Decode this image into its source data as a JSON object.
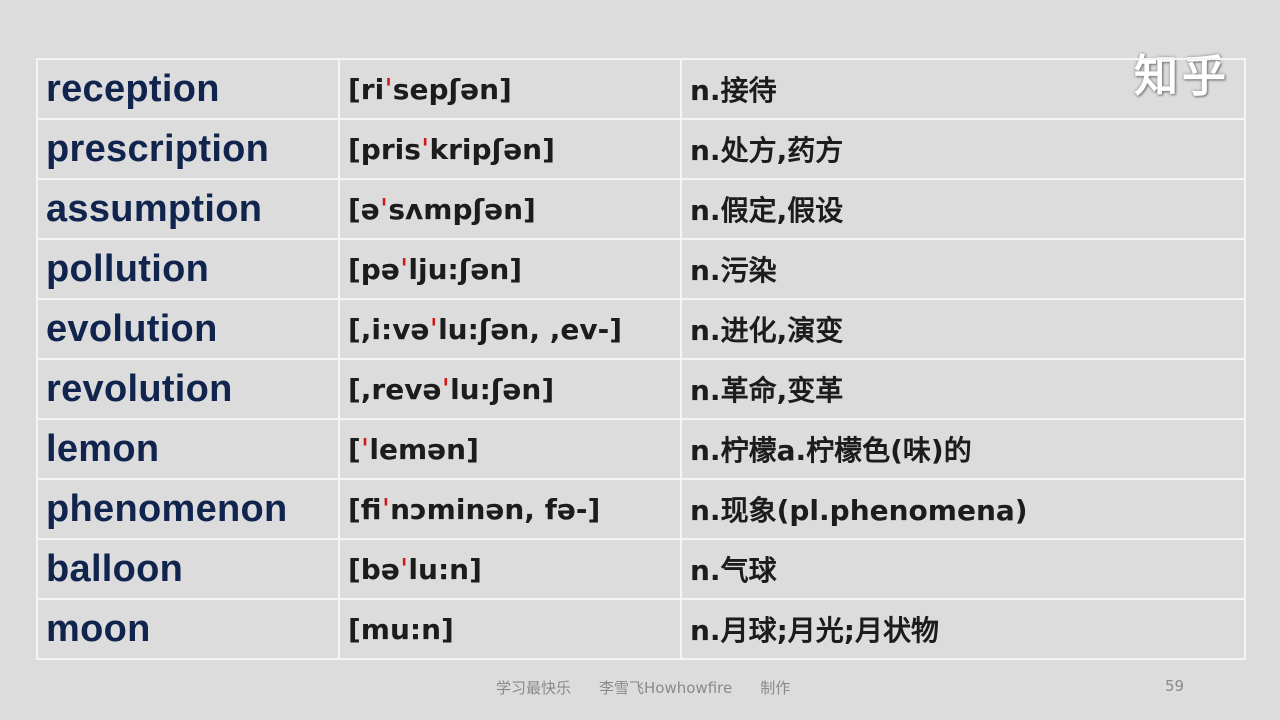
{
  "watermark": "知乎",
  "rows": [
    {
      "word": "reception",
      "ipa_pre": "[ri",
      "ipa_post": "sepʃən]",
      "definition": "n.接待"
    },
    {
      "word": "prescription",
      "ipa_pre": "[pris",
      "ipa_post": "kripʃən]",
      "definition": "n.处方,药方"
    },
    {
      "word": "assumption",
      "ipa_pre": "[ə",
      "ipa_post": "sʌmpʃən]",
      "definition": "n.假定,假设"
    },
    {
      "word": "pollution",
      "ipa_pre": "[pə",
      "ipa_post": "lju:ʃən]",
      "definition": "n.污染"
    },
    {
      "word": "evolution",
      "ipa_pre": "[,i:və",
      "ipa_post": "lu:ʃən, ,ev-]",
      "definition": "n.进化,演变"
    },
    {
      "word": "revolution",
      "ipa_pre": "[,revə",
      "ipa_post": "lu:ʃən]",
      "definition": "n.革命,变革"
    },
    {
      "word": "lemon",
      "ipa_pre": "[",
      "ipa_post": "lemən]",
      "definition": "n.柠檬a.柠檬色(味)的"
    },
    {
      "word": "phenomenon",
      "ipa_pre": "[fi",
      "ipa_post": "nɔminən, fə-]",
      "definition": "n.现象(pl.phenomena)"
    },
    {
      "word": "balloon",
      "ipa_pre": "[bə",
      "ipa_post": "lu:n]",
      "definition": "n.气球"
    },
    {
      "word": "moon",
      "ipa_pre": "[mu:n]",
      "ipa_post": "",
      "definition": "n.月球;月光;月状物"
    }
  ],
  "stress_mark": "ˈ",
  "footer": {
    "slogan": "学习最快乐",
    "author": "李雪飞Howhowfire",
    "made_by": "制作",
    "page_number": "59"
  },
  "colors": {
    "background": "#dcdcdc",
    "word_text": "#10244e",
    "stress_mark": "#d01818"
  }
}
